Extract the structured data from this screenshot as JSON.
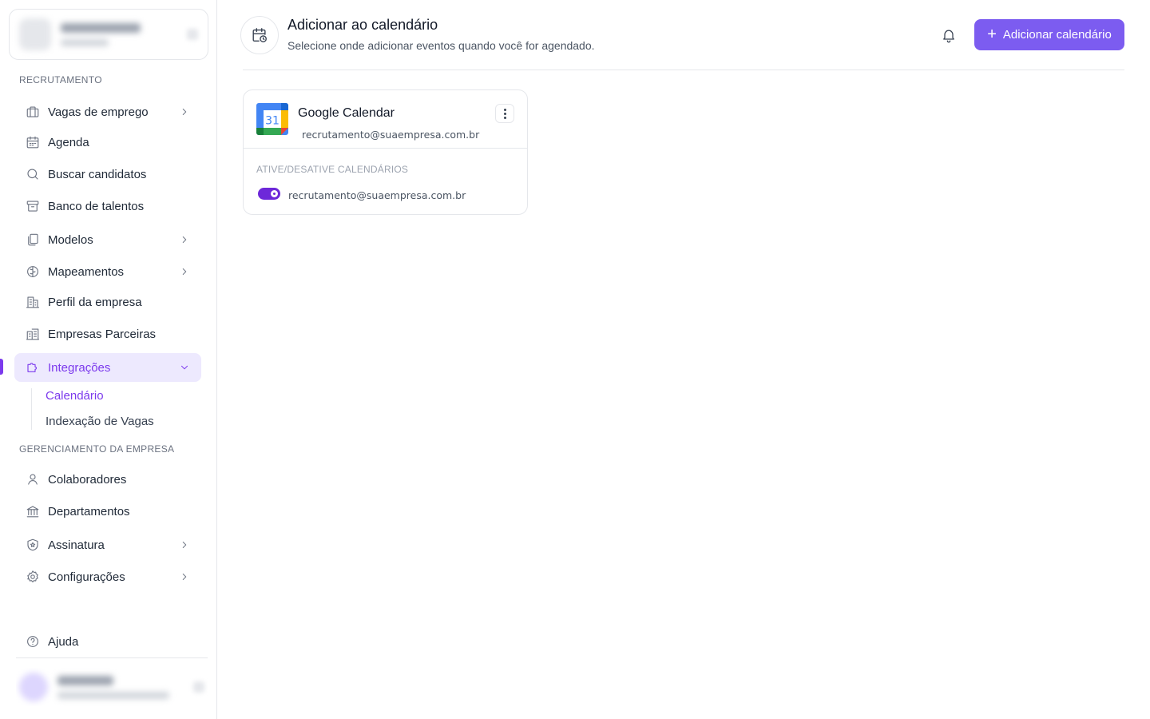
{
  "sidebar": {
    "sections": {
      "recruitment": "RECRUTAMENTO",
      "company_management": "GERENCIAMENTO DA EMPRESA"
    },
    "items": {
      "jobs": "Vagas de emprego",
      "agenda": "Agenda",
      "search_candidates": "Buscar candidatos",
      "talent_pool": "Banco de talentos",
      "templates": "Modelos",
      "mappings": "Mapeamentos",
      "company_profile": "Perfil da empresa",
      "partner_companies": "Empresas Parceiras",
      "integrations": "Integrações",
      "calendar": "Calendário",
      "job_indexing": "Indexação de Vagas",
      "collaborators": "Colaboradores",
      "departments": "Departamentos",
      "subscription": "Assinatura",
      "settings": "Configurações",
      "help": "Ajuda"
    }
  },
  "header": {
    "title": "Adicionar ao calendário",
    "subtitle": "Selecione onde adicionar eventos quando você for agendado.",
    "add_button": "Adicionar calendário",
    "add_icon": "+"
  },
  "calendar_card": {
    "provider": "Google Calendar",
    "logo_day": "31",
    "account_email": "recrutamento@suaempresa.com.br",
    "toggle_section_title": "ATIVE/DESATIVE CALENDÁRIOS",
    "calendars": [
      {
        "label": "recrutamento@suaempresa.com.br",
        "enabled": true
      }
    ]
  },
  "colors": {
    "accent": "#7c5cf0",
    "accent_text": "#7c3aed",
    "active_bg": "#ede9fe",
    "toggle_on": "#6d28d9"
  }
}
